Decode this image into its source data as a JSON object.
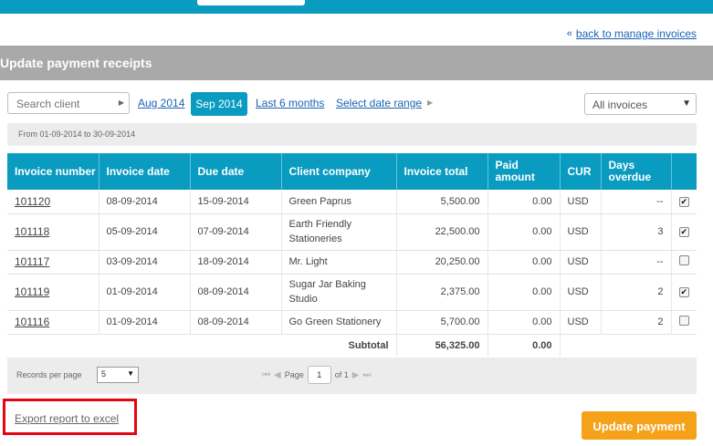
{
  "header": {
    "back_link": "back to manage invoices",
    "title": "Update payment receipts"
  },
  "filters": {
    "search_placeholder": "Search client",
    "months": [
      "Aug 2014",
      "Sep 2014"
    ],
    "active_month": "Sep 2014",
    "last_6_months": "Last 6 months",
    "select_date_range": "Select date range",
    "invoice_filter": "All invoices",
    "range_text": "From 01-09-2014 to 30-09-2014"
  },
  "table": {
    "columns": [
      "Invoice number",
      "Invoice date",
      "Due date",
      "Client company",
      "Invoice total",
      "Paid amount",
      "CUR",
      "Days overdue",
      ""
    ],
    "rows": [
      {
        "invoice_number": "101120",
        "invoice_date": "08-09-2014",
        "due_date": "15-09-2014",
        "client": "Green Paprus",
        "total": "5,500.00",
        "paid": "0.00",
        "cur": "USD",
        "days_overdue": "--",
        "checked": true
      },
      {
        "invoice_number": "101118",
        "invoice_date": "05-09-2014",
        "due_date": "07-09-2014",
        "client": "Earth Friendly Stationeries",
        "total": "22,500.00",
        "paid": "0.00",
        "cur": "USD",
        "days_overdue": "3",
        "checked": true
      },
      {
        "invoice_number": "101117",
        "invoice_date": "03-09-2014",
        "due_date": "18-09-2014",
        "client": "Mr. Light",
        "total": "20,250.00",
        "paid": "0.00",
        "cur": "USD",
        "days_overdue": "--",
        "checked": false
      },
      {
        "invoice_number": "101119",
        "invoice_date": "01-09-2014",
        "due_date": "08-09-2014",
        "client": "Sugar Jar Baking Studio",
        "total": "2,375.00",
        "paid": "0.00",
        "cur": "USD",
        "days_overdue": "2",
        "checked": true
      },
      {
        "invoice_number": "101116",
        "invoice_date": "01-09-2014",
        "due_date": "08-09-2014",
        "client": "Go Green Stationery",
        "total": "5,700.00",
        "paid": "0.00",
        "cur": "USD",
        "days_overdue": "2",
        "checked": false
      }
    ],
    "subtotal_label": "Subtotal",
    "subtotal_total": "56,325.00",
    "subtotal_paid": "0.00"
  },
  "pagination": {
    "records_per_page_label": "Records per page",
    "records_per_page": "5",
    "page_label": "Page",
    "page": "1",
    "of_label": "of 1"
  },
  "actions": {
    "export": "Export report to excel",
    "update": "Update payment"
  },
  "colors": {
    "accent": "#0a9bc1",
    "title_bar": "#a9a9a9",
    "update_button": "#f5a21a",
    "highlight_box": "#e30613"
  },
  "icons": {
    "back": "double-chevron-left-icon",
    "dropdown": "caret-down-icon"
  }
}
